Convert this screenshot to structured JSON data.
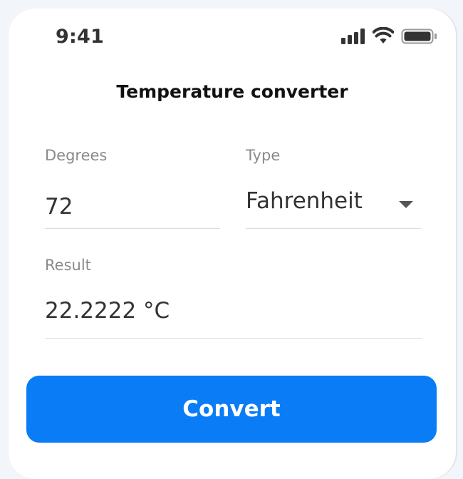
{
  "status_bar": {
    "time": "9:41",
    "icons": [
      "signal-icon",
      "wifi-icon",
      "battery-icon"
    ]
  },
  "screen": {
    "title": "Temperature converter"
  },
  "form": {
    "degrees": {
      "label": "Degrees",
      "value": "72"
    },
    "type": {
      "label": "Type",
      "selected": "Fahrenheit"
    },
    "result": {
      "label": "Result",
      "value": "22.2222 °C"
    },
    "convert_label": "Convert"
  },
  "colors": {
    "accent": "#0a7cf6",
    "background": "#f2f5fa",
    "card": "#ffffff",
    "label": "#8a8a8a",
    "text": "#333333"
  }
}
